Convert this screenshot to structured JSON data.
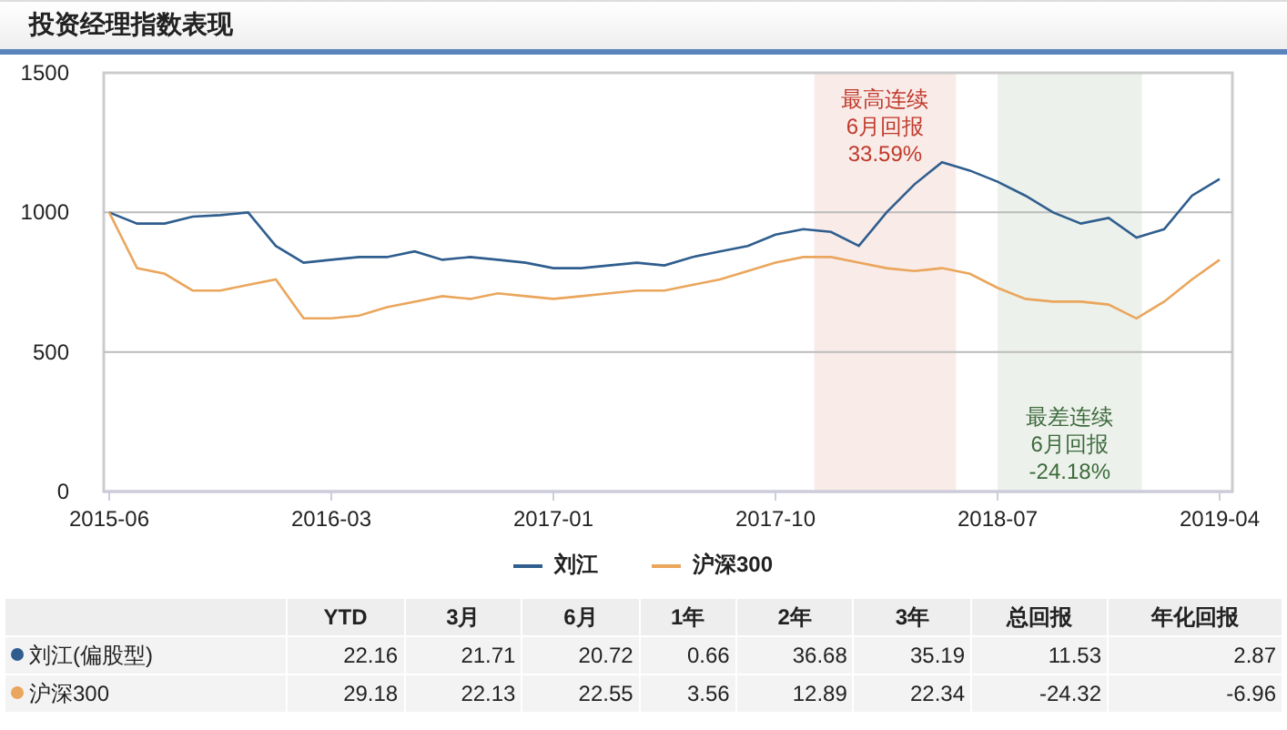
{
  "header": {
    "title": "投资经理指数表现"
  },
  "chart": {
    "chart_data": {
      "type": "line",
      "categories": [
        "2015-06",
        null,
        null,
        null,
        null,
        null,
        null,
        null,
        "2016-03",
        null,
        null,
        null,
        null,
        null,
        null,
        null,
        "2017-01",
        null,
        null,
        null,
        null,
        null,
        null,
        null,
        "2017-10",
        null,
        null,
        null,
        null,
        null,
        null,
        null,
        "2018-07",
        null,
        null,
        null,
        null,
        null,
        null,
        null,
        "2019-04"
      ],
      "ylim": [
        0,
        1500
      ],
      "yticks": [
        0,
        500,
        1000,
        1500
      ],
      "series": [
        {
          "name": "刘江",
          "color": "#2f5e8e",
          "values": [
            1000,
            960,
            960,
            985,
            990,
            1000,
            880,
            820,
            830,
            840,
            840,
            860,
            830,
            840,
            830,
            820,
            800,
            800,
            810,
            820,
            810,
            840,
            860,
            880,
            920,
            940,
            930,
            880,
            1000,
            1100,
            1180,
            1150,
            1110,
            1060,
            1000,
            960,
            980,
            910,
            940,
            1060,
            1120
          ]
        },
        {
          "name": "沪深300",
          "color": "#eaa65c",
          "values": [
            1000,
            800,
            780,
            720,
            720,
            740,
            760,
            620,
            620,
            630,
            660,
            680,
            700,
            690,
            710,
            700,
            690,
            700,
            710,
            720,
            720,
            740,
            760,
            790,
            820,
            840,
            840,
            820,
            800,
            790,
            800,
            780,
            730,
            690,
            680,
            680,
            670,
            620,
            680,
            760,
            830
          ]
        }
      ],
      "legend": "bottom"
    },
    "highlights": [
      {
        "kind": "best",
        "text": "最高连续\n6月回报\n33.59%"
      },
      {
        "kind": "worst",
        "text": "最差连续\n6月回报\n-24.18%"
      }
    ]
  },
  "table": {
    "columns": [
      "YTD",
      "3月",
      "6月",
      "1年",
      "2年",
      "3年",
      "总回报",
      "年化回报"
    ],
    "rows": [
      {
        "name": "刘江(偏股型)",
        "color": "#2f5e8e",
        "values": [
          "22.16",
          "21.71",
          "20.72",
          "0.66",
          "36.68",
          "35.19",
          "11.53",
          "2.87"
        ]
      },
      {
        "name": "沪深300",
        "color": "#eaa65c",
        "values": [
          "29.18",
          "22.13",
          "22.55",
          "3.56",
          "12.89",
          "22.34",
          "-24.32",
          "-6.96"
        ]
      }
    ]
  }
}
